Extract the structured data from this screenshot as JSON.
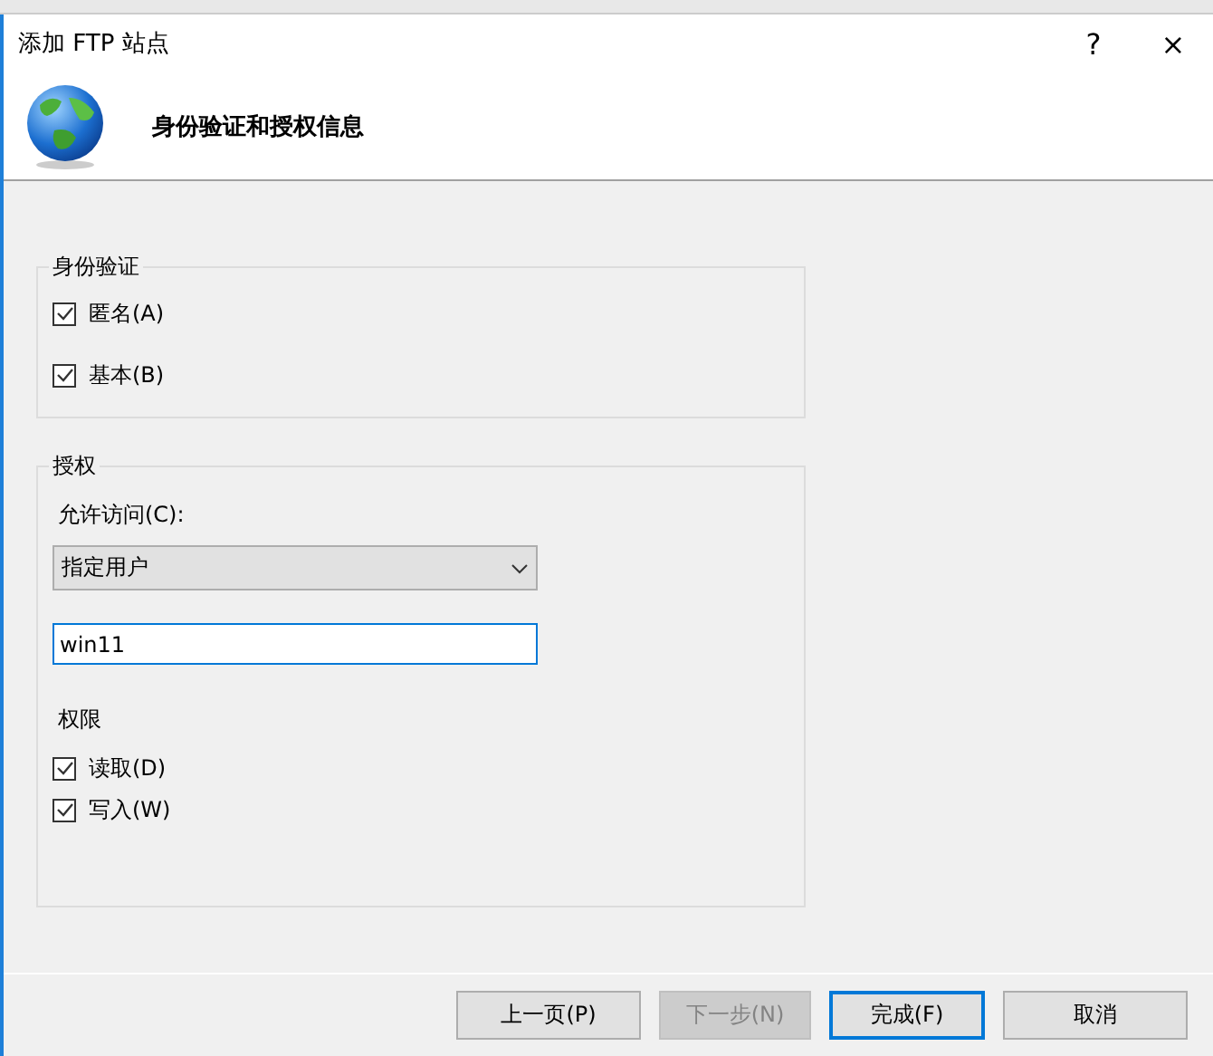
{
  "window": {
    "title": "添加 FTP 站点",
    "help": "?",
    "close": "×"
  },
  "header": {
    "title": "身份验证和授权信息"
  },
  "authentication": {
    "title": "身份验证",
    "options": [
      {
        "label": "匿名(A)",
        "checked": true
      },
      {
        "label": "基本(B)",
        "checked": true
      }
    ]
  },
  "authorization": {
    "title": "授权",
    "access_label": "允许访问(C):",
    "access_value": "指定用户",
    "user_value": "win11",
    "permissions_title": "权限",
    "permissions": [
      {
        "label": "读取(D)",
        "checked": true
      },
      {
        "label": "写入(W)",
        "checked": true
      }
    ]
  },
  "buttons": [
    {
      "label": "上一页(P)",
      "disabled": false,
      "focused": false
    },
    {
      "label": "下一步(N)",
      "disabled": true,
      "focused": false
    },
    {
      "label": "完成(F)",
      "disabled": false,
      "focused": true
    },
    {
      "label": "取消",
      "disabled": false,
      "focused": false
    }
  ]
}
